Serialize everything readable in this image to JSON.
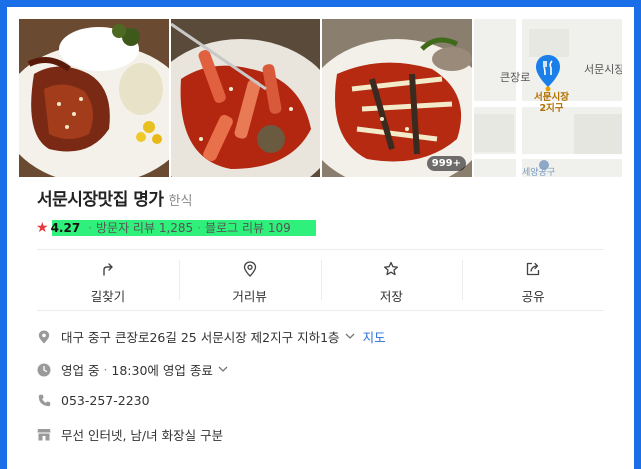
{
  "photos": {
    "count_badge": "999+",
    "map": {
      "road_label": "큰장로",
      "area_label": "서문시장",
      "pin_label_line1": "서문시장",
      "pin_label_line2": "2지구",
      "bottom_label": "세양공구"
    }
  },
  "place": {
    "name": "서문시장맛집 명가",
    "category": "한식",
    "rating": "4.27",
    "visitor_reviews": "방문자 리뷰 1,285",
    "blog_reviews": "블로그 리뷰 109",
    "highlight_color": "#2ef07a",
    "star_color": "#e8383d"
  },
  "actions": [
    {
      "label": "길찾기",
      "icon": "directions-icon"
    },
    {
      "label": "거리뷰",
      "icon": "map-pin-icon"
    },
    {
      "label": "저장",
      "icon": "star-outline-icon"
    },
    {
      "label": "공유",
      "icon": "share-icon"
    }
  ],
  "info": {
    "address": "대구 중구 큰장로26길 25 서문시장 제2지구 지하1층",
    "address_map_link": "지도",
    "hours_status": "영업 중",
    "hours_detail": "18:30에 영업 종료",
    "phone": "053-257-2230",
    "amenities": "무선 인터넷, 남/녀 화장실 구분"
  },
  "colors": {
    "frame": "#1a6fe8",
    "link": "#2a6fdb"
  }
}
